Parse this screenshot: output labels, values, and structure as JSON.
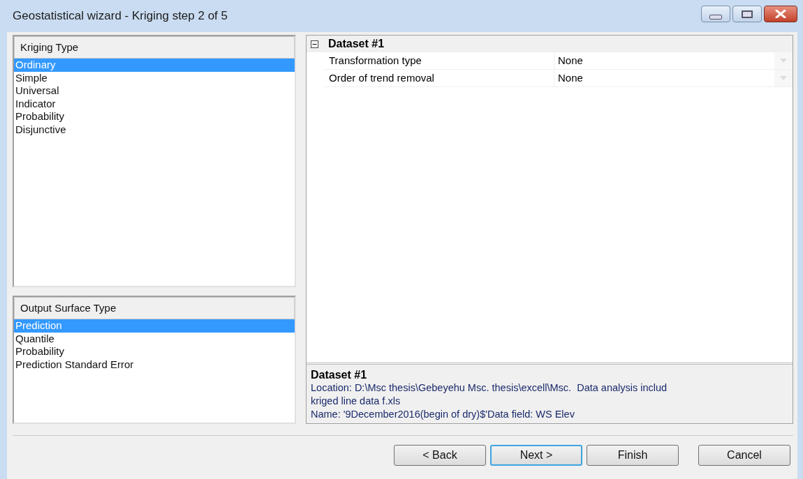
{
  "window": {
    "title": "Geostatistical wizard - Kriging step 2 of 5"
  },
  "kriging_type": {
    "heading": "Kriging Type",
    "items": [
      {
        "label": "Ordinary",
        "selected": true
      },
      {
        "label": "Simple",
        "selected": false
      },
      {
        "label": "Universal",
        "selected": false
      },
      {
        "label": "Indicator",
        "selected": false
      },
      {
        "label": "Probability",
        "selected": false
      },
      {
        "label": "Disjunctive",
        "selected": false
      }
    ]
  },
  "output_surface_type": {
    "heading": "Output Surface Type",
    "items": [
      {
        "label": "Prediction",
        "selected": true
      },
      {
        "label": "Quantile",
        "selected": false
      },
      {
        "label": "Probability",
        "selected": false
      },
      {
        "label": "Prediction Standard Error",
        "selected": false
      }
    ]
  },
  "properties": {
    "category": "Dataset #1",
    "expanded": true,
    "rows": [
      {
        "name": "Transformation type",
        "value": "None"
      },
      {
        "name": "Order of trend removal",
        "value": "None"
      }
    ]
  },
  "description": {
    "title": "Dataset #1",
    "lines": [
      "Location: D:\\Msc thesis\\Gebeyehu Msc. thesis\\excell\\Msc.  Data analysis includ",
      "kriged line data f.xls",
      "Name: '9December2016(begin of dry)$'Data field: WS Elev"
    ]
  },
  "buttons": [
    {
      "label": "< Back",
      "focused": false
    },
    {
      "label": "Next >",
      "focused": true
    },
    {
      "label": "Finish",
      "focused": false
    },
    {
      "label": "Cancel",
      "focused": false
    }
  ]
}
